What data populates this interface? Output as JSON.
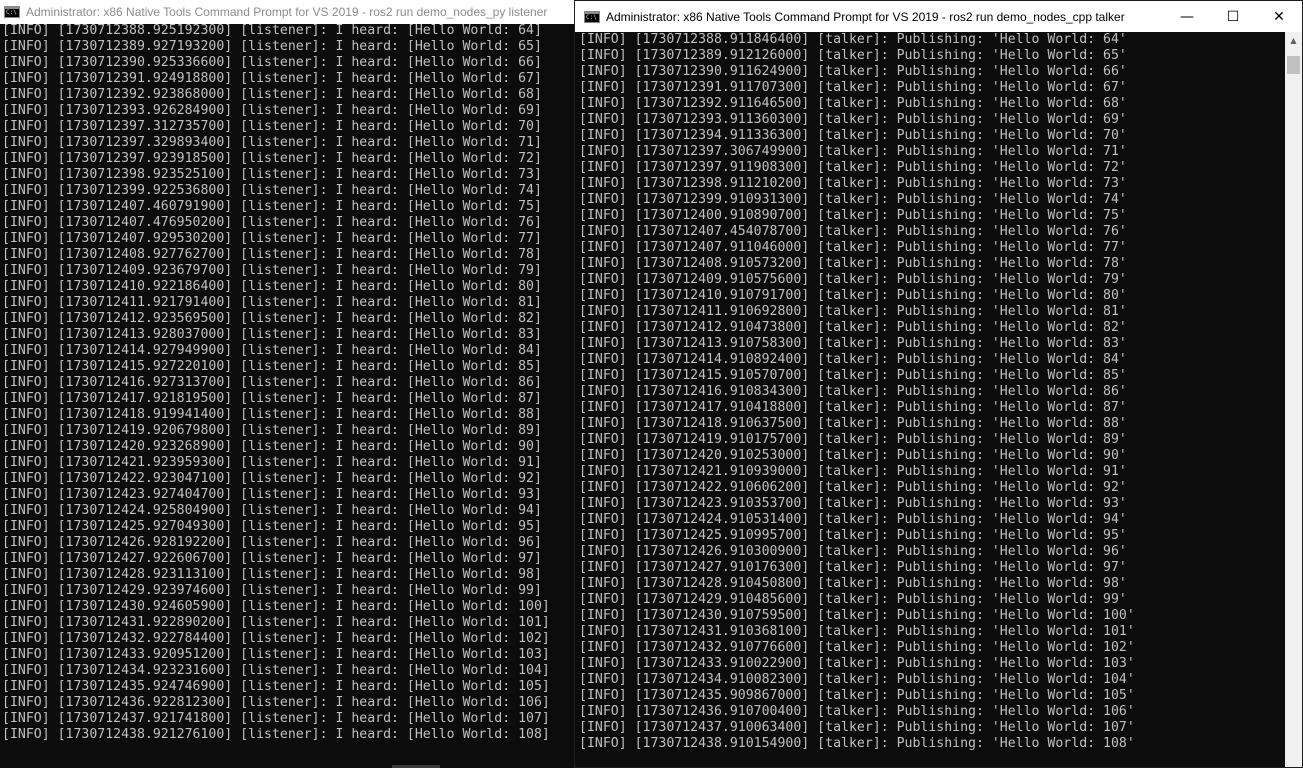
{
  "left_window": {
    "title": "Administrator: x86 Native Tools Command Prompt for VS 2019 - ros2  run demo_nodes_py listener",
    "lines": [
      "[INFO] [1730712388.925192300] [listener]: I heard: [Hello World: 64]",
      "[INFO] [1730712389.927193200] [listener]: I heard: [Hello World: 65]",
      "[INFO] [1730712390.925336600] [listener]: I heard: [Hello World: 66]",
      "[INFO] [1730712391.924918800] [listener]: I heard: [Hello World: 67]",
      "[INFO] [1730712392.923868000] [listener]: I heard: [Hello World: 68]",
      "[INFO] [1730712393.926284900] [listener]: I heard: [Hello World: 69]",
      "[INFO] [1730712397.312735700] [listener]: I heard: [Hello World: 70]",
      "[INFO] [1730712397.329893400] [listener]: I heard: [Hello World: 71]",
      "[INFO] [1730712397.923918500] [listener]: I heard: [Hello World: 72]",
      "[INFO] [1730712398.923525100] [listener]: I heard: [Hello World: 73]",
      "[INFO] [1730712399.922536800] [listener]: I heard: [Hello World: 74]",
      "[INFO] [1730712407.460791900] [listener]: I heard: [Hello World: 75]",
      "[INFO] [1730712407.476950200] [listener]: I heard: [Hello World: 76]",
      "[INFO] [1730712407.929530200] [listener]: I heard: [Hello World: 77]",
      "[INFO] [1730712408.927762700] [listener]: I heard: [Hello World: 78]",
      "[INFO] [1730712409.923679700] [listener]: I heard: [Hello World: 79]",
      "[INFO] [1730712410.922186400] [listener]: I heard: [Hello World: 80]",
      "[INFO] [1730712411.921791400] [listener]: I heard: [Hello World: 81]",
      "[INFO] [1730712412.923569500] [listener]: I heard: [Hello World: 82]",
      "[INFO] [1730712413.928037000] [listener]: I heard: [Hello World: 83]",
      "[INFO] [1730712414.927949900] [listener]: I heard: [Hello World: 84]",
      "[INFO] [1730712415.927220100] [listener]: I heard: [Hello World: 85]",
      "[INFO] [1730712416.927313700] [listener]: I heard: [Hello World: 86]",
      "[INFO] [1730712417.921819500] [listener]: I heard: [Hello World: 87]",
      "[INFO] [1730712418.919941400] [listener]: I heard: [Hello World: 88]",
      "[INFO] [1730712419.920679800] [listener]: I heard: [Hello World: 89]",
      "[INFO] [1730712420.923268900] [listener]: I heard: [Hello World: 90]",
      "[INFO] [1730712421.923959300] [listener]: I heard: [Hello World: 91]",
      "[INFO] [1730712422.923047100] [listener]: I heard: [Hello World: 92]",
      "[INFO] [1730712423.927404700] [listener]: I heard: [Hello World: 93]",
      "[INFO] [1730712424.925804900] [listener]: I heard: [Hello World: 94]",
      "[INFO] [1730712425.927049300] [listener]: I heard: [Hello World: 95]",
      "[INFO] [1730712426.928192200] [listener]: I heard: [Hello World: 96]",
      "[INFO] [1730712427.922606700] [listener]: I heard: [Hello World: 97]",
      "[INFO] [1730712428.923113100] [listener]: I heard: [Hello World: 98]",
      "[INFO] [1730712429.923974600] [listener]: I heard: [Hello World: 99]",
      "[INFO] [1730712430.924605900] [listener]: I heard: [Hello World: 100]",
      "[INFO] [1730712431.922890200] [listener]: I heard: [Hello World: 101]",
      "[INFO] [1730712432.922784400] [listener]: I heard: [Hello World: 102]",
      "[INFO] [1730712433.920951200] [listener]: I heard: [Hello World: 103]",
      "[INFO] [1730712434.923231600] [listener]: I heard: [Hello World: 104]",
      "[INFO] [1730712435.924746900] [listener]: I heard: [Hello World: 105]",
      "[INFO] [1730712436.922812300] [listener]: I heard: [Hello World: 106]",
      "[INFO] [1730712437.921741800] [listener]: I heard: [Hello World: 107]",
      "[INFO] [1730712438.921276100] [listener]: I heard: [Hello World: 108]"
    ]
  },
  "right_window": {
    "title": "Administrator: x86 Native Tools Command Prompt for VS 2019 - ros2  run demo_nodes_cpp talker",
    "controls": {
      "minimize": "—",
      "maximize": "☐",
      "close": "✕"
    },
    "lines": [
      "[INFO] [1730712388.911846400] [talker]: Publishing: 'Hello World: 64'",
      "[INFO] [1730712389.912126000] [talker]: Publishing: 'Hello World: 65'",
      "[INFO] [1730712390.911624900] [talker]: Publishing: 'Hello World: 66'",
      "[INFO] [1730712391.911707300] [talker]: Publishing: 'Hello World: 67'",
      "[INFO] [1730712392.911646500] [talker]: Publishing: 'Hello World: 68'",
      "[INFO] [1730712393.911360300] [talker]: Publishing: 'Hello World: 69'",
      "[INFO] [1730712394.911336300] [talker]: Publishing: 'Hello World: 70'",
      "[INFO] [1730712397.306749900] [talker]: Publishing: 'Hello World: 71'",
      "[INFO] [1730712397.911908300] [talker]: Publishing: 'Hello World: 72'",
      "[INFO] [1730712398.911210200] [talker]: Publishing: 'Hello World: 73'",
      "[INFO] [1730712399.910931300] [talker]: Publishing: 'Hello World: 74'",
      "[INFO] [1730712400.910890700] [talker]: Publishing: 'Hello World: 75'",
      "[INFO] [1730712407.454078700] [talker]: Publishing: 'Hello World: 76'",
      "[INFO] [1730712407.911046000] [talker]: Publishing: 'Hello World: 77'",
      "[INFO] [1730712408.910573200] [talker]: Publishing: 'Hello World: 78'",
      "[INFO] [1730712409.910575600] [talker]: Publishing: 'Hello World: 79'",
      "[INFO] [1730712410.910791700] [talker]: Publishing: 'Hello World: 80'",
      "[INFO] [1730712411.910692800] [talker]: Publishing: 'Hello World: 81'",
      "[INFO] [1730712412.910473800] [talker]: Publishing: 'Hello World: 82'",
      "[INFO] [1730712413.910758300] [talker]: Publishing: 'Hello World: 83'",
      "[INFO] [1730712414.910892400] [talker]: Publishing: 'Hello World: 84'",
      "[INFO] [1730712415.910570700] [talker]: Publishing: 'Hello World: 85'",
      "[INFO] [1730712416.910834300] [talker]: Publishing: 'Hello World: 86'",
      "[INFO] [1730712417.910418800] [talker]: Publishing: 'Hello World: 87'",
      "[INFO] [1730712418.910637500] [talker]: Publishing: 'Hello World: 88'",
      "[INFO] [1730712419.910175700] [talker]: Publishing: 'Hello World: 89'",
      "[INFO] [1730712420.910253000] [talker]: Publishing: 'Hello World: 90'",
      "[INFO] [1730712421.910939000] [talker]: Publishing: 'Hello World: 91'",
      "[INFO] [1730712422.910606200] [talker]: Publishing: 'Hello World: 92'",
      "[INFO] [1730712423.910353700] [talker]: Publishing: 'Hello World: 93'",
      "[INFO] [1730712424.910531400] [talker]: Publishing: 'Hello World: 94'",
      "[INFO] [1730712425.910995700] [talker]: Publishing: 'Hello World: 95'",
      "[INFO] [1730712426.910300900] [talker]: Publishing: 'Hello World: 96'",
      "[INFO] [1730712427.910176300] [talker]: Publishing: 'Hello World: 97'",
      "[INFO] [1730712428.910450800] [talker]: Publishing: 'Hello World: 98'",
      "[INFO] [1730712429.910485600] [talker]: Publishing: 'Hello World: 99'",
      "[INFO] [1730712430.910759500] [talker]: Publishing: 'Hello World: 100'",
      "[INFO] [1730712431.910368100] [talker]: Publishing: 'Hello World: 101'",
      "[INFO] [1730712432.910776600] [talker]: Publishing: 'Hello World: 102'",
      "[INFO] [1730712433.910022900] [talker]: Publishing: 'Hello World: 103'",
      "[INFO] [1730712434.910082300] [talker]: Publishing: 'Hello World: 104'",
      "[INFO] [1730712435.909867000] [talker]: Publishing: 'Hello World: 105'",
      "[INFO] [1730712436.910700400] [talker]: Publishing: 'Hello World: 106'",
      "[INFO] [1730712437.910063400] [talker]: Publishing: 'Hello World: 107'",
      "[INFO] [1730712438.910154900] [talker]: Publishing: 'Hello World: 108'"
    ]
  },
  "icons": {
    "window_icon": "cmd-icon",
    "scroll_up": "scroll-up-arrow-icon"
  },
  "colors": {
    "console_bg": "#0c0c0c",
    "console_fg": "#c0c0c0",
    "titlebar_active_bg": "#ffffff",
    "titlebar_inactive_fg": "#8c8c8c"
  }
}
